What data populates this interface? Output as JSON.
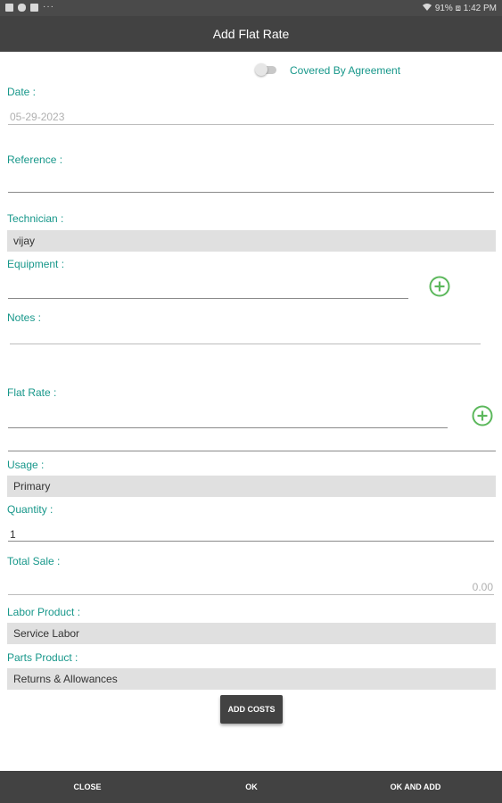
{
  "status_bar": {
    "left_icons": [
      "image-icon",
      "cloud-icon",
      "photo-icon"
    ],
    "overflow": "···",
    "right_text": "91% ⧈ 1:42 PM"
  },
  "header": {
    "title": "Add Flat Rate"
  },
  "form": {
    "covered_by_agreement": {
      "label": "Covered By Agreement",
      "on": false
    },
    "date": {
      "label": "Date :",
      "value": "05-29-2023"
    },
    "reference": {
      "label": "Reference :",
      "value": ""
    },
    "technician": {
      "label": "Technician :",
      "value": "vijay"
    },
    "equipment": {
      "label": "Equipment :",
      "value": ""
    },
    "notes": {
      "label": "Notes :",
      "value": ""
    },
    "flat_rate": {
      "label": "Flat Rate :",
      "value": ""
    },
    "usage": {
      "label": "Usage :",
      "value": "Primary"
    },
    "quantity": {
      "label": "Quantity :",
      "value": "1"
    },
    "total_sale": {
      "label": "Total Sale :",
      "value": "0.00"
    },
    "labor_product": {
      "label": "Labor Product :",
      "value": "Service Labor"
    },
    "parts_product": {
      "label": "Parts Product :",
      "value": "Returns & Allowances"
    }
  },
  "buttons": {
    "add_costs": "ADD COSTS",
    "close": "CLOSE",
    "ok": "OK",
    "ok_and_add": "OK AND ADD"
  },
  "colors": {
    "accent": "#17978a",
    "plus_icon": "#5cb85c",
    "bar_dark": "#424242",
    "field_grey": "#e0e0e0"
  }
}
